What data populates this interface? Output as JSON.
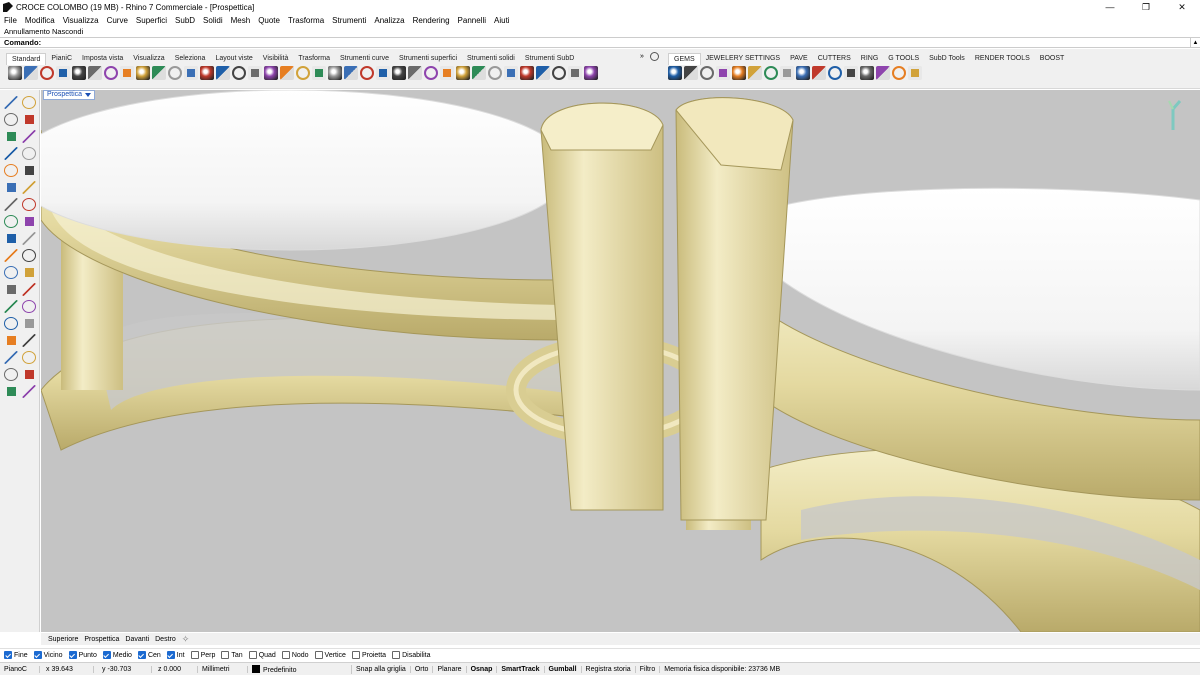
{
  "window": {
    "title": "CROCE COLOMBO (19 MB) - Rhino 7 Commerciale - [Prospettica]",
    "minimize": "—",
    "maximize": "❐",
    "close": "✕"
  },
  "menu": [
    "File",
    "Modifica",
    "Visualizza",
    "Curve",
    "Superfici",
    "SubD",
    "Solidi",
    "Mesh",
    "Quote",
    "Trasforma",
    "Strumenti",
    "Analizza",
    "Rendering",
    "Pannelli",
    "Aiuti"
  ],
  "command": {
    "history": "Annullamento Nascondi",
    "label": "Comando:",
    "value": ""
  },
  "toolbar": {
    "tabs_left": [
      "Standard",
      "PianiC",
      "Imposta vista",
      "Visualizza",
      "Seleziona",
      "Layout viste",
      "Visibilità",
      "Trasforma",
      "Strumenti curve",
      "Strumenti superfici",
      "Strumenti solidi",
      "Strumenti SubD"
    ],
    "more": "»",
    "tabs_right": [
      "GEMS",
      "JEWELERY SETTINGS",
      "PAVE",
      "CUTTERS",
      "RING",
      "G TOOLS",
      "SubD Tools",
      "RENDER TOOLS",
      "BOOST"
    ]
  },
  "viewport": {
    "label": "Prospettica"
  },
  "view_tabs": [
    "Superiore",
    "Prospettica",
    "Davanti",
    "Destro"
  ],
  "osnaps": [
    {
      "label": "Fine",
      "on": true
    },
    {
      "label": "Vicino",
      "on": true
    },
    {
      "label": "Punto",
      "on": true
    },
    {
      "label": "Medio",
      "on": true
    },
    {
      "label": "Cen",
      "on": true
    },
    {
      "label": "Int",
      "on": true
    },
    {
      "label": "Perp",
      "on": false
    },
    {
      "label": "Tan",
      "on": false
    },
    {
      "label": "Quad",
      "on": false
    },
    {
      "label": "Nodo",
      "on": false
    },
    {
      "label": "Vertice",
      "on": false
    },
    {
      "label": "Proietta",
      "on": false
    },
    {
      "label": "Disabilita",
      "on": false
    }
  ],
  "status": {
    "cplane": "PianoC",
    "x": "x 39.643",
    "y": "y -30.703",
    "z": "z 0.000",
    "units": "Millimetri",
    "layer": "Predefinito",
    "snap": "Snap alla griglia",
    "ortho": "Orto",
    "planar": "Planare",
    "osnap": "Osnap",
    "smarttrack": "SmartTrack",
    "gumball": "Gumball",
    "history": "Registra storia",
    "filter": "Filtro",
    "memory": "Memoria fisica disponibile: 23736 MB"
  },
  "colors": {
    "gold": "#e9e1b0",
    "gold_dark": "#b7a866",
    "viewport_bg": "#c4c4c4",
    "accent": "#1b6ad1"
  }
}
